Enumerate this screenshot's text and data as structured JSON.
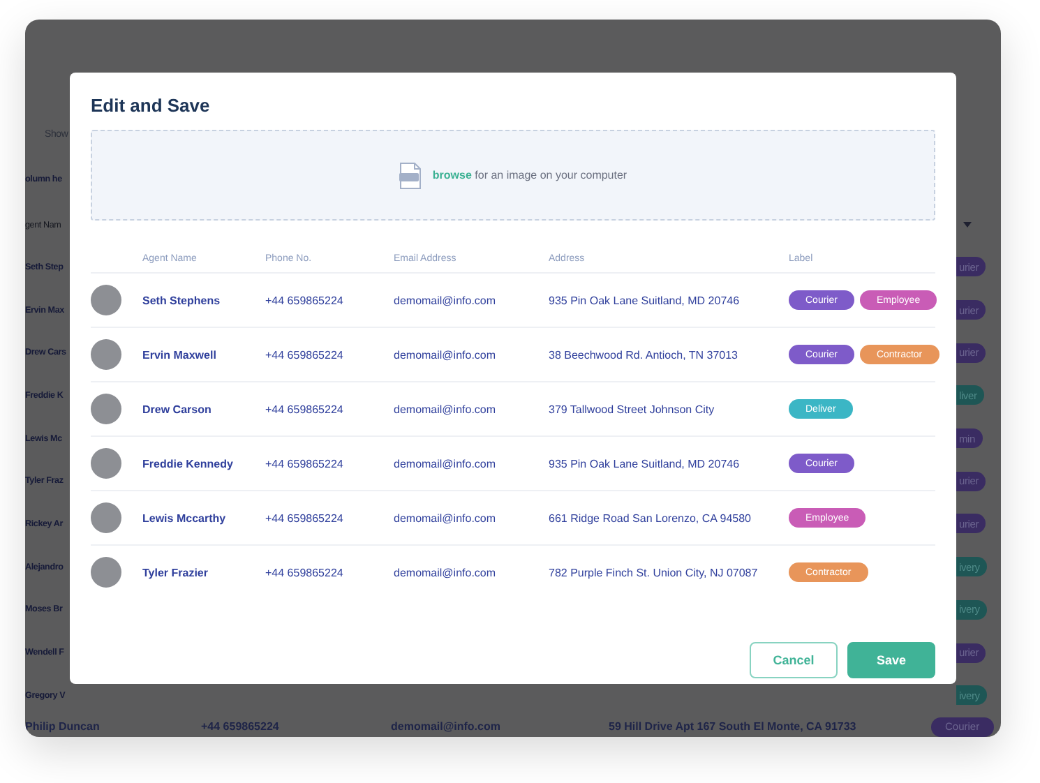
{
  "background": {
    "show_label": "Show",
    "column_heading": "olumn he",
    "agent_heading": "gent Nam",
    "rows": [
      {
        "name": "Seth Step",
        "label": "urier",
        "kind": "courier"
      },
      {
        "name": "Ervin Max",
        "label": "urier",
        "kind": "courier"
      },
      {
        "name": "Drew Cars",
        "label": "urier",
        "kind": "courier"
      },
      {
        "name": "Freddie K",
        "label": "liver",
        "kind": "delivery"
      },
      {
        "name": "Lewis Mc",
        "label": "min",
        "kind": "courier"
      },
      {
        "name": "Tyler Fraz",
        "label": "urier",
        "kind": "courier"
      },
      {
        "name": "Rickey Ar",
        "label": "urier",
        "kind": "courier"
      },
      {
        "name": "Alejandro",
        "label": "ivery",
        "kind": "delivery"
      },
      {
        "name": "Moses Br",
        "label": "ivery",
        "kind": "delivery"
      },
      {
        "name": "Wendell F",
        "label": "urier",
        "kind": "courier"
      },
      {
        "name": "Gregory V",
        "label": "ivery",
        "kind": "delivery"
      }
    ],
    "last_row": {
      "name": "Philip Duncan",
      "phone": "+44 659865224",
      "email": "demomail@info.com",
      "address": "59 Hill Drive Apt 167 South El Monte, CA 91733",
      "label": "Courier",
      "kind": "courier"
    }
  },
  "dialog": {
    "title": "Edit and Save",
    "upload": {
      "link": "browse",
      "text": "for an image on your computer"
    },
    "columns": [
      "Agent Name",
      "Phone No.",
      "Email Address",
      "Address",
      "Label"
    ],
    "rows": [
      {
        "name": "Seth Stephens",
        "phone": "+44 659865224",
        "email": "demomail@info.com",
        "address": "935 Pin Oak Lane Suitland, MD 20746",
        "labels": [
          {
            "text": "Courier",
            "color": "#7e5bc9"
          },
          {
            "text": "Employee",
            "color": "#c95cb6"
          }
        ]
      },
      {
        "name": "Ervin Maxwell",
        "phone": "+44 659865224",
        "email": "demomail@info.com",
        "address": "38 Beechwood Rd. Antioch, TN 37013",
        "labels": [
          {
            "text": "Courier",
            "color": "#7e5bc9"
          },
          {
            "text": "Contractor",
            "color": "#e8955a"
          }
        ]
      },
      {
        "name": "Drew Carson",
        "phone": "+44 659865224",
        "email": "demomail@info.com",
        "address": "379 Tallwood Street Johnson City",
        "labels": [
          {
            "text": "Deliver",
            "color": "#3bb6c5"
          }
        ]
      },
      {
        "name": "Freddie Kennedy",
        "phone": "+44 659865224",
        "email": "demomail@info.com",
        "address": "935 Pin Oak Lane Suitland, MD 20746",
        "labels": [
          {
            "text": "Courier",
            "color": "#7e5bc9"
          }
        ]
      },
      {
        "name": "Lewis Mccarthy",
        "phone": "+44 659865224",
        "email": "demomail@info.com",
        "address": "661 Ridge Road San Lorenzo, CA 94580",
        "labels": [
          {
            "text": "Employee",
            "color": "#c95cb6"
          }
        ]
      },
      {
        "name": "Tyler Frazier",
        "phone": "+44 659865224",
        "email": "demomail@info.com",
        "address": "782 Purple Finch St. Union City, NJ 07087",
        "labels": [
          {
            "text": "Contractor",
            "color": "#e8955a"
          }
        ]
      }
    ],
    "buttons": [
      {
        "text": "Cancel",
        "kind": "secondary"
      },
      {
        "text": "Save",
        "kind": "primary"
      }
    ]
  }
}
